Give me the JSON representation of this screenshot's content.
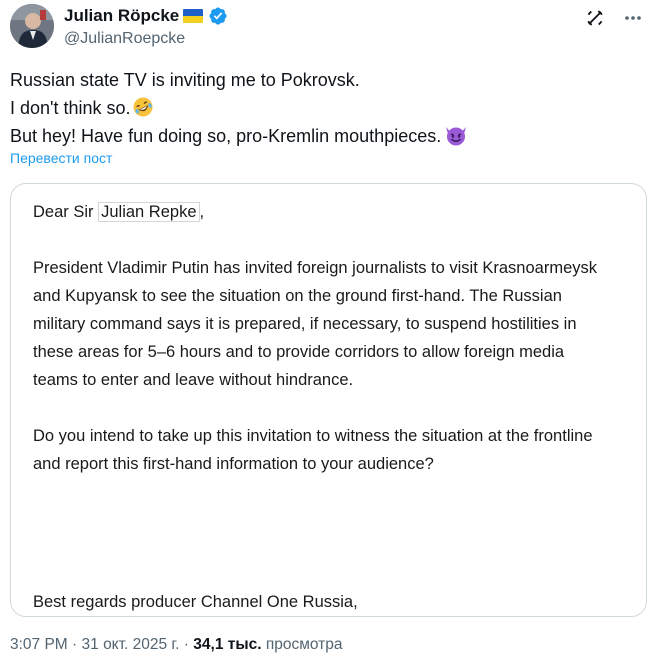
{
  "author": {
    "display_name": "Julian Röpcke",
    "handle": "@JulianRoepcke",
    "flag_icon": "ukraine-flag-icon",
    "verified_icon": "verified-badge-icon",
    "verified_color": "#1d9bf0"
  },
  "actions": {
    "grok_icon": "grok-icon",
    "more_icon": "more-dots-icon"
  },
  "tweet": {
    "line1": "Russian state TV is inviting me to Pokrovsk.",
    "line2": "I don't think so.",
    "line2_emoji": "rolling-on-floor-laughing-emoji",
    "line3": "But hey! Have fun doing so, pro-Kremlin mouthpieces.",
    "line3_emoji": "smiling-face-with-horns-emoji",
    "translate_label": "Перевести пост"
  },
  "letter": {
    "greeting_prefix": "Dear Sir ",
    "greeting_name": "Julian Repke",
    "greeting_suffix": ",",
    "p1_l1": "President Vladimir Putin has invited foreign journalists to visit Krasnoarmeysk",
    "p1_l2": "and Kupyansk to see the situation on the ground first-hand. The Russian",
    "p1_l3": "military command says it is prepared, if necessary, to suspend hostilities in",
    "p1_l4": "these areas for 5–6 hours and to provide corridors to allow foreign media",
    "p1_l5": "teams to enter and leave without hindrance.",
    "p2_l1": "Do you intend to take up this invitation to witness the situation at the frontline",
    "p2_l2": "and report this first-hand information to your audience?",
    "signoff": "Best regards producer Channel One Russia,"
  },
  "meta": {
    "time": "3:07 PM",
    "sep1": " · ",
    "date": "31 окт. 2025 г.",
    "sep2": " · ",
    "views_count": "34,1 тыс.",
    "views_label": " просмотра"
  },
  "colors": {
    "accent": "#1d9bf0",
    "secondary_text": "#536471",
    "card_border": "#cfd9de"
  }
}
